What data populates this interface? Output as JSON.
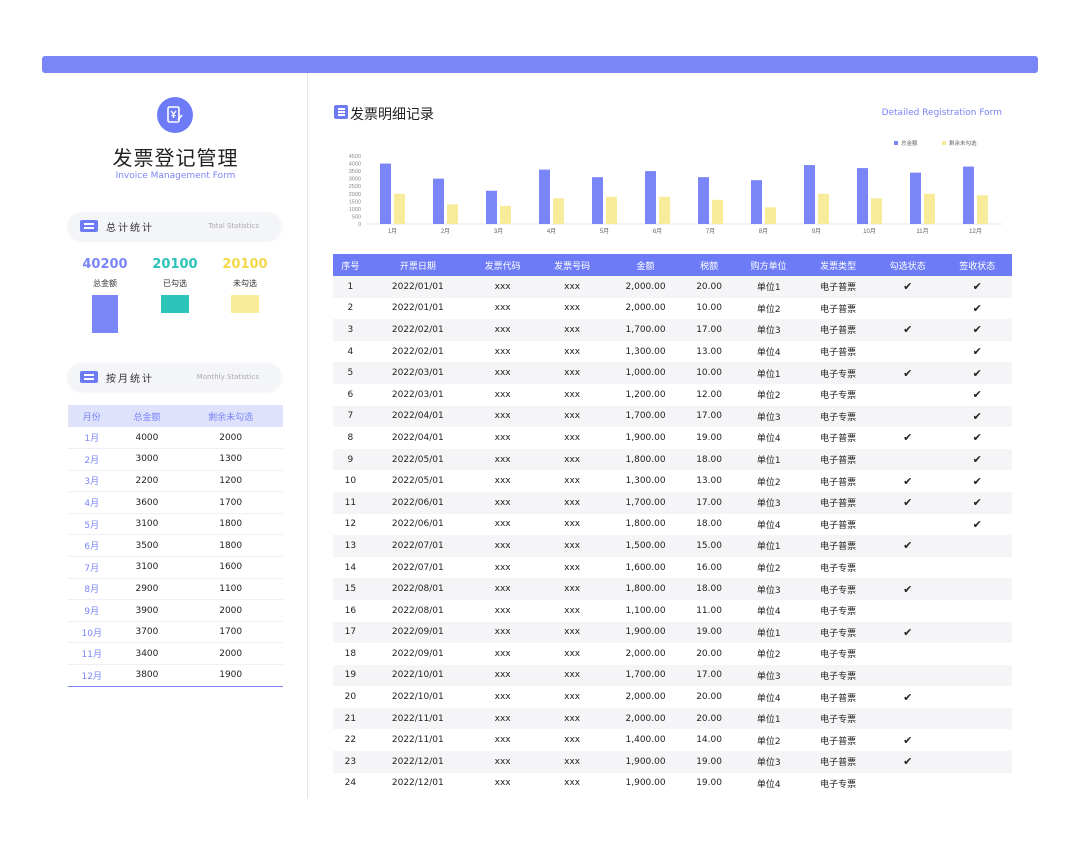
{
  "header": {
    "title": "发票登记管理",
    "subtitle": "Invoice Management Form"
  },
  "total_stats": {
    "label": "总计统计",
    "sublabel": "Total Statistics",
    "items": [
      {
        "value": "40200",
        "label": "总金额",
        "color": "#7a86f8"
      },
      {
        "value": "20100",
        "label": "已勾选",
        "color": "#2cc3b8"
      },
      {
        "value": "20100",
        "label": "未勾选",
        "color": "#f4e06e"
      }
    ]
  },
  "monthly_stats": {
    "label": "按月统计",
    "sublabel": "Monthly Statistics",
    "columns": [
      "月份",
      "总金额",
      "剩余未勾选"
    ],
    "rows": [
      [
        "1月",
        "4000",
        "2000"
      ],
      [
        "2月",
        "3000",
        "1300"
      ],
      [
        "3月",
        "2200",
        "1200"
      ],
      [
        "4月",
        "3600",
        "1700"
      ],
      [
        "5月",
        "3100",
        "1800"
      ],
      [
        "6月",
        "3500",
        "1800"
      ],
      [
        "7月",
        "3100",
        "1600"
      ],
      [
        "8月",
        "2900",
        "1100"
      ],
      [
        "9月",
        "3900",
        "2000"
      ],
      [
        "10月",
        "3700",
        "1700"
      ],
      [
        "11月",
        "3400",
        "2000"
      ],
      [
        "12月",
        "3800",
        "1900"
      ]
    ]
  },
  "detail": {
    "title": "发票明细记录",
    "subtitle": "Detailed Registration Form",
    "columns": [
      "序号",
      "开票日期",
      "发票代码",
      "发票号码",
      "金额",
      "税额",
      "购方单位",
      "发票类型",
      "勾选状态",
      "签收状态"
    ],
    "rows": [
      [
        "1",
        "2022/01/01",
        "xxx",
        "xxx",
        "2,000.00",
        "20.00",
        "单位1",
        "电子普票",
        "✔",
        "✔"
      ],
      [
        "2",
        "2022/01/01",
        "xxx",
        "xxx",
        "2,000.00",
        "10.00",
        "单位2",
        "电子普票",
        "",
        "✔"
      ],
      [
        "3",
        "2022/02/01",
        "xxx",
        "xxx",
        "1,700.00",
        "17.00",
        "单位3",
        "电子普票",
        "✔",
        "✔"
      ],
      [
        "4",
        "2022/02/01",
        "xxx",
        "xxx",
        "1,300.00",
        "13.00",
        "单位4",
        "电子普票",
        "",
        "✔"
      ],
      [
        "5",
        "2022/03/01",
        "xxx",
        "xxx",
        "1,000.00",
        "10.00",
        "单位1",
        "电子专票",
        "✔",
        "✔"
      ],
      [
        "6",
        "2022/03/01",
        "xxx",
        "xxx",
        "1,200.00",
        "12.00",
        "单位2",
        "电子专票",
        "",
        "✔"
      ],
      [
        "7",
        "2022/04/01",
        "xxx",
        "xxx",
        "1,700.00",
        "17.00",
        "单位3",
        "电子专票",
        "",
        "✔"
      ],
      [
        "8",
        "2022/04/01",
        "xxx",
        "xxx",
        "1,900.00",
        "19.00",
        "单位4",
        "电子普票",
        "✔",
        "✔"
      ],
      [
        "9",
        "2022/05/01",
        "xxx",
        "xxx",
        "1,800.00",
        "18.00",
        "单位1",
        "电子普票",
        "",
        "✔"
      ],
      [
        "10",
        "2022/05/01",
        "xxx",
        "xxx",
        "1,300.00",
        "13.00",
        "单位2",
        "电子普票",
        "✔",
        "✔"
      ],
      [
        "11",
        "2022/06/01",
        "xxx",
        "xxx",
        "1,700.00",
        "17.00",
        "单位3",
        "电子普票",
        "✔",
        "✔"
      ],
      [
        "12",
        "2022/06/01",
        "xxx",
        "xxx",
        "1,800.00",
        "18.00",
        "单位4",
        "电子普票",
        "",
        "✔"
      ],
      [
        "13",
        "2022/07/01",
        "xxx",
        "xxx",
        "1,500.00",
        "15.00",
        "单位1",
        "电子普票",
        "✔",
        ""
      ],
      [
        "14",
        "2022/07/01",
        "xxx",
        "xxx",
        "1,600.00",
        "16.00",
        "单位2",
        "电子专票",
        "",
        ""
      ],
      [
        "15",
        "2022/08/01",
        "xxx",
        "xxx",
        "1,800.00",
        "18.00",
        "单位3",
        "电子专票",
        "✔",
        ""
      ],
      [
        "16",
        "2022/08/01",
        "xxx",
        "xxx",
        "1,100.00",
        "11.00",
        "单位4",
        "电子专票",
        "",
        ""
      ],
      [
        "17",
        "2022/09/01",
        "xxx",
        "xxx",
        "1,900.00",
        "19.00",
        "单位1",
        "电子专票",
        "✔",
        ""
      ],
      [
        "18",
        "2022/09/01",
        "xxx",
        "xxx",
        "2,000.00",
        "20.00",
        "单位2",
        "电子专票",
        "",
        ""
      ],
      [
        "19",
        "2022/10/01",
        "xxx",
        "xxx",
        "1,700.00",
        "17.00",
        "单位3",
        "电子专票",
        "",
        ""
      ],
      [
        "20",
        "2022/10/01",
        "xxx",
        "xxx",
        "2,000.00",
        "20.00",
        "单位4",
        "电子普票",
        "✔",
        ""
      ],
      [
        "21",
        "2022/11/01",
        "xxx",
        "xxx",
        "2,000.00",
        "20.00",
        "单位1",
        "电子专票",
        "",
        ""
      ],
      [
        "22",
        "2022/11/01",
        "xxx",
        "xxx",
        "1,400.00",
        "14.00",
        "单位2",
        "电子普票",
        "✔",
        ""
      ],
      [
        "23",
        "2022/12/01",
        "xxx",
        "xxx",
        "1,900.00",
        "19.00",
        "单位3",
        "电子普票",
        "✔",
        ""
      ],
      [
        "24",
        "2022/12/01",
        "xxx",
        "xxx",
        "1,900.00",
        "19.00",
        "单位4",
        "电子专票",
        "",
        ""
      ]
    ]
  },
  "chart_data": {
    "type": "bar",
    "categories": [
      "1月",
      "2月",
      "3月",
      "4月",
      "5月",
      "6月",
      "7月",
      "8月",
      "9月",
      "10月",
      "11月",
      "12月"
    ],
    "series": [
      {
        "name": "总金额",
        "color": "#7a86f8",
        "values": [
          4000,
          3000,
          2200,
          3600,
          3100,
          3500,
          3100,
          2900,
          3900,
          3700,
          3400,
          3800
        ]
      },
      {
        "name": "剩余未勾选",
        "color": "#f8eb9a",
        "values": [
          2000,
          1300,
          1200,
          1700,
          1800,
          1800,
          1600,
          1100,
          2000,
          1700,
          2000,
          1900
        ]
      }
    ],
    "ylim": [
      0,
      4500
    ],
    "yticks": [
      0,
      500,
      1000,
      1500,
      2000,
      2500,
      3000,
      3500,
      4000,
      4500
    ],
    "legend": "top-right"
  }
}
